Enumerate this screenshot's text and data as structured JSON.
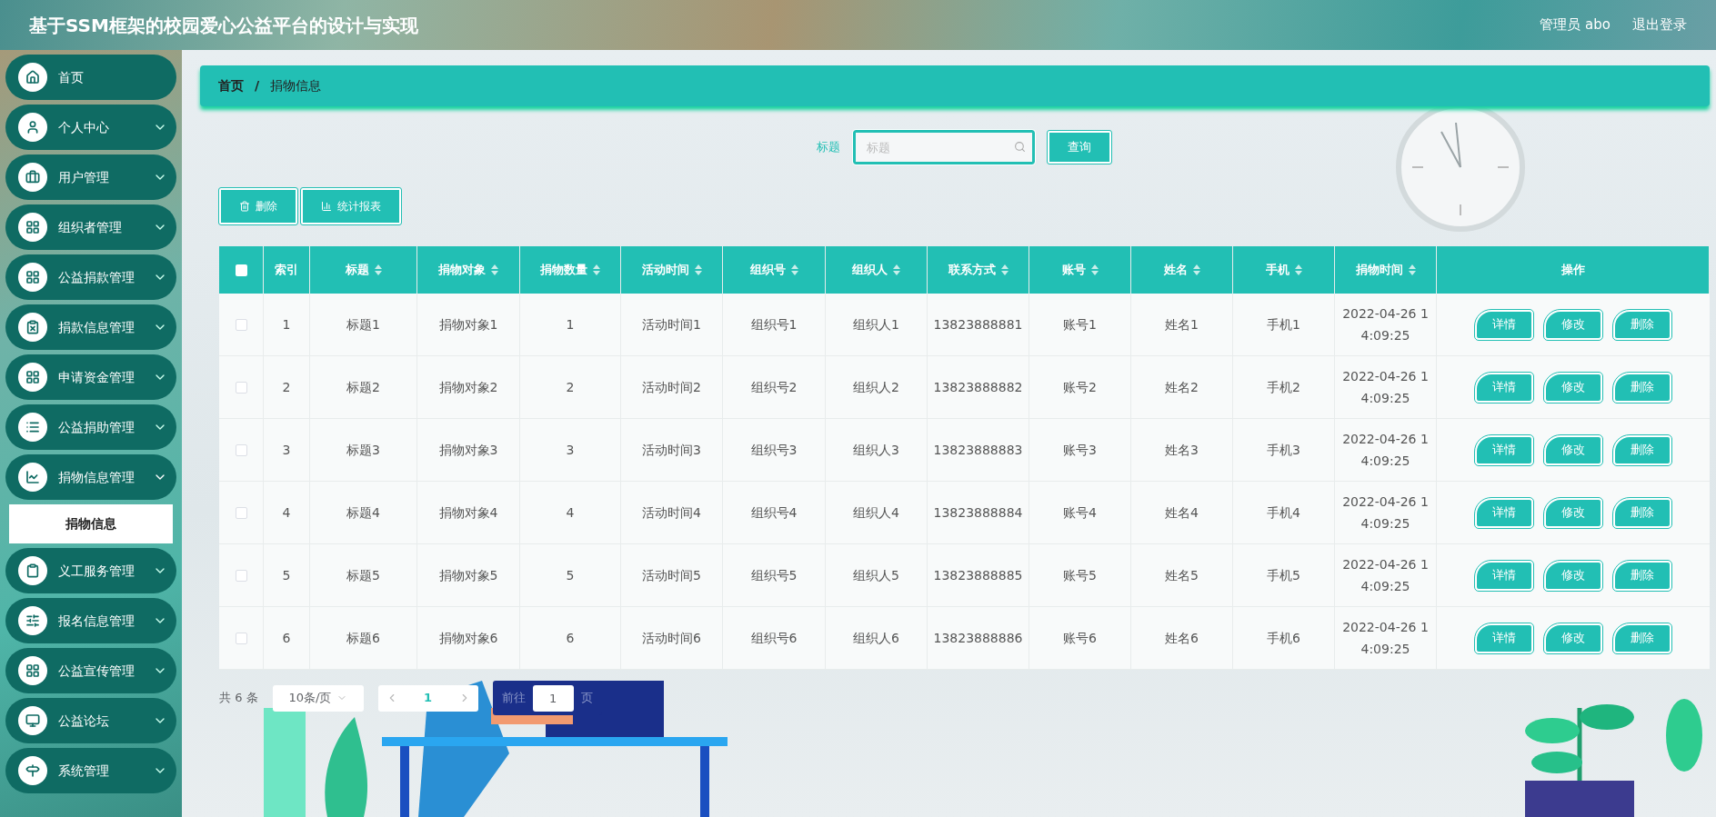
{
  "header": {
    "title": "基于SSM框架的校园爱心公益平台的设计与实现",
    "user": "管理员 abo",
    "logout": "退出登录"
  },
  "sidebar": {
    "items": [
      {
        "label": "首页",
        "expandable": false
      },
      {
        "label": "个人中心",
        "expandable": true,
        "expanded": false
      },
      {
        "label": "用户管理",
        "expandable": true,
        "expanded": false
      },
      {
        "label": "组织者管理",
        "expandable": true,
        "expanded": false
      },
      {
        "label": "公益捐款管理",
        "expandable": true,
        "expanded": false
      },
      {
        "label": "捐款信息管理",
        "expandable": true,
        "expanded": false
      },
      {
        "label": "申请资金管理",
        "expandable": true,
        "expanded": false
      },
      {
        "label": "公益捐助管理",
        "expandable": true,
        "expanded": false
      },
      {
        "label": "捐物信息管理",
        "expandable": true,
        "expanded": true,
        "children": [
          {
            "label": "捐物信息",
            "selected": true
          }
        ]
      },
      {
        "label": "义工服务管理",
        "expandable": true,
        "expanded": false
      },
      {
        "label": "报名信息管理",
        "expandable": true,
        "expanded": false
      },
      {
        "label": "公益宣传管理",
        "expandable": true,
        "expanded": false
      },
      {
        "label": "公益论坛",
        "expandable": true,
        "expanded": false
      },
      {
        "label": "系统管理",
        "expandable": true,
        "expanded": false
      }
    ]
  },
  "breadcrumb": {
    "items": [
      "首页",
      "捐物信息"
    ],
    "separator": "/"
  },
  "search": {
    "label": "标题",
    "placeholder": "标题",
    "button": "查询"
  },
  "toolbar": [
    {
      "label": "删除",
      "kind": "delete"
    },
    {
      "label": "统计报表",
      "kind": "chart"
    }
  ],
  "table": {
    "select_all_checked": false,
    "columns": [
      {
        "label": "索引",
        "sortable": false
      },
      {
        "label": "标题",
        "sortable": true
      },
      {
        "label": "捐物对象",
        "sortable": true
      },
      {
        "label": "捐物数量",
        "sortable": true
      },
      {
        "label": "活动时间",
        "sortable": true
      },
      {
        "label": "组织号",
        "sortable": true
      },
      {
        "label": "组织人",
        "sortable": true
      },
      {
        "label": "联系方式",
        "sortable": true
      },
      {
        "label": "账号",
        "sortable": true
      },
      {
        "label": "姓名",
        "sortable": true
      },
      {
        "label": "手机",
        "sortable": true
      },
      {
        "label": "捐物时间",
        "sortable": true
      },
      {
        "label": "操作",
        "sortable": false
      }
    ],
    "rows": [
      {
        "checked": false,
        "cells": [
          "1",
          "标题1",
          "捐物对象1",
          "1",
          "活动时间1",
          "组织号1",
          "组织人1",
          "13823888881",
          "账号1",
          "姓名1",
          "手机1",
          "2022-04-26 14:09:25"
        ],
        "actions": [
          "详情",
          "修改",
          "删除"
        ]
      },
      {
        "checked": false,
        "cells": [
          "2",
          "标题2",
          "捐物对象2",
          "2",
          "活动时间2",
          "组织号2",
          "组织人2",
          "13823888882",
          "账号2",
          "姓名2",
          "手机2",
          "2022-04-26 14:09:25"
        ],
        "actions": [
          "详情",
          "修改",
          "删除"
        ]
      },
      {
        "checked": false,
        "cells": [
          "3",
          "标题3",
          "捐物对象3",
          "3",
          "活动时间3",
          "组织号3",
          "组织人3",
          "13823888883",
          "账号3",
          "姓名3",
          "手机3",
          "2022-04-26 14:09:25"
        ],
        "actions": [
          "详情",
          "修改",
          "删除"
        ]
      },
      {
        "checked": false,
        "cells": [
          "4",
          "标题4",
          "捐物对象4",
          "4",
          "活动时间4",
          "组织号4",
          "组织人4",
          "13823888884",
          "账号4",
          "姓名4",
          "手机4",
          "2022-04-26 14:09:25"
        ],
        "actions": [
          "详情",
          "修改",
          "删除"
        ]
      },
      {
        "checked": false,
        "cells": [
          "5",
          "标题5",
          "捐物对象5",
          "5",
          "活动时间5",
          "组织号5",
          "组织人5",
          "13823888885",
          "账号5",
          "姓名5",
          "手机5",
          "2022-04-26 14:09:25"
        ],
        "actions": [
          "详情",
          "修改",
          "删除"
        ]
      },
      {
        "checked": false,
        "cells": [
          "6",
          "标题6",
          "捐物对象6",
          "6",
          "活动时间6",
          "组织号6",
          "组织人6",
          "13823888886",
          "账号6",
          "姓名6",
          "手机6",
          "2022-04-26 14:09:25"
        ],
        "actions": [
          "详情",
          "修改",
          "删除"
        ]
      }
    ]
  },
  "pagination": {
    "total": "共 6 条",
    "page_size": "10条/页",
    "pages": [
      {
        "label": "1",
        "selected": true
      }
    ],
    "goto_label": "前往",
    "goto_value": "1",
    "goto_suffix": "页"
  }
}
